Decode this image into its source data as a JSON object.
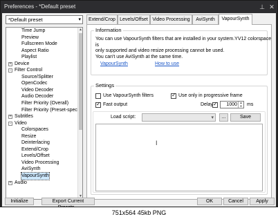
{
  "window": {
    "title": "Preferences - *Default preset",
    "pin_icon": "pin-icon",
    "close_icon": "close-icon"
  },
  "preset": {
    "selected": "*Default preset"
  },
  "tree": [
    {
      "label": "Time Jump",
      "level": 1
    },
    {
      "label": "Preview",
      "level": 1
    },
    {
      "label": "Fullscreen Mode",
      "level": 1
    },
    {
      "label": "Aspect Ratio",
      "level": 1
    },
    {
      "label": "Playlist",
      "level": 1
    },
    {
      "label": "Device",
      "level": 0,
      "expander": "+"
    },
    {
      "label": "Filter Control",
      "level": 0,
      "expander": "-"
    },
    {
      "label": "Source/Splitter",
      "level": 1
    },
    {
      "label": "OpenCodec",
      "level": 1
    },
    {
      "label": "Video Decoder",
      "level": 1
    },
    {
      "label": "Audio Decoder",
      "level": 1
    },
    {
      "label": "Filter Priority (Overall)",
      "level": 1
    },
    {
      "label": "Filter Priority (Preset-specific)",
      "level": 1
    },
    {
      "label": "Subtitles",
      "level": 0,
      "expander": "+"
    },
    {
      "label": "Video",
      "level": 0,
      "expander": "-"
    },
    {
      "label": "Colorspaces",
      "level": 1
    },
    {
      "label": "Resize",
      "level": 1
    },
    {
      "label": "Deinterlacing",
      "level": 1
    },
    {
      "label": "Extend/Crop",
      "level": 1
    },
    {
      "label": "Levels/Offset",
      "level": 1
    },
    {
      "label": "Video Processing",
      "level": 1
    },
    {
      "label": "AviSynth",
      "level": 1
    },
    {
      "label": "VapourSynth",
      "level": 1,
      "selected": true
    },
    {
      "label": "Audio",
      "level": 0,
      "expander": "+"
    }
  ],
  "tabs": [
    "Extend/Crop",
    "Levels/Offset",
    "Video Processing",
    "AviSynth",
    "VapourSynth"
  ],
  "active_tab": "VapourSynth",
  "information": {
    "title": "Information",
    "text_line1": "You can use VapourSynth filters that are installed in your system.YV12 colorspace is",
    "text_line2": "only supported and video resize processing cannot be used.",
    "text_line3": "You can't use AviSynth at the same time.",
    "link1": "VapourSynth",
    "link2": "How to use"
  },
  "settings": {
    "title": "Settings",
    "use_filters": {
      "label": "Use VapourSynth filters",
      "checked": false
    },
    "progressive_only": {
      "label": "Use only in progressive frame",
      "checked": true
    },
    "fast_output": {
      "label": "Fast output",
      "checked": true
    },
    "delay": {
      "label": "Delay",
      "checked": true,
      "value": "1000",
      "unit": "ms"
    },
    "load_script_label": "Load script:",
    "browse_label": "...",
    "save_label": "Save"
  },
  "buttons": {
    "initialize": "Initialize",
    "export": "Export Current Presets...",
    "ok": "OK",
    "cancel": "Cancel",
    "apply": "Apply"
  },
  "caption": "751x564  45kb  PNG"
}
